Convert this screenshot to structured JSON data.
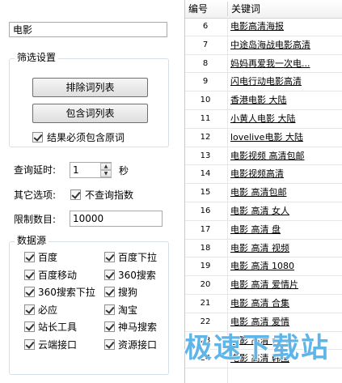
{
  "keyword_input": {
    "value": "电影"
  },
  "filter_group": {
    "title": "筛选设置",
    "exclude_button": "排除词列表",
    "include_button": "包含词列表",
    "must_contain_label": "结果必须包含原词",
    "must_contain_checked": true
  },
  "query_delay": {
    "label": "查询延时:",
    "value": "1",
    "unit": "秒"
  },
  "other_options": {
    "label": "其它选项:",
    "no_index_label": "不查询指数",
    "no_index_checked": true
  },
  "limit": {
    "label": "限制数目:",
    "value": "10000"
  },
  "sources_group": {
    "title": "数据源",
    "items": [
      {
        "label": "百度",
        "checked": true
      },
      {
        "label": "百度下拉",
        "checked": true
      },
      {
        "label": "百度移动",
        "checked": true
      },
      {
        "label": "360搜索",
        "checked": true
      },
      {
        "label": "360搜索下拉",
        "checked": true
      },
      {
        "label": "搜狗",
        "checked": true
      },
      {
        "label": "必应",
        "checked": true
      },
      {
        "label": "淘宝",
        "checked": true
      },
      {
        "label": "站长工具",
        "checked": true
      },
      {
        "label": "神马搜索",
        "checked": true
      },
      {
        "label": "云端接口",
        "checked": true
      },
      {
        "label": "资源接口",
        "checked": true
      }
    ]
  },
  "results": {
    "headers": {
      "num": "编号",
      "keyword": "关键词"
    },
    "rows": [
      {
        "num": "6",
        "keyword": "电影高清海报"
      },
      {
        "num": "7",
        "keyword": "中途岛海战电影高清"
      },
      {
        "num": "8",
        "keyword": "妈妈再爱我一次电..."
      },
      {
        "num": "9",
        "keyword": "闪电行动电影高清"
      },
      {
        "num": "10",
        "keyword": "香港电影 大陆"
      },
      {
        "num": "11",
        "keyword": "小黄人电影 大陆"
      },
      {
        "num": "12",
        "keyword": "lovelive电影 大陆"
      },
      {
        "num": "13",
        "keyword": "电影视频 高清包邮"
      },
      {
        "num": "14",
        "keyword": "电影视频高清"
      },
      {
        "num": "15",
        "keyword": "电影 高清包邮"
      },
      {
        "num": "16",
        "keyword": "电影 高清 女人"
      },
      {
        "num": "17",
        "keyword": "电影 高清 盘"
      },
      {
        "num": "18",
        "keyword": "电影 高清 视频"
      },
      {
        "num": "19",
        "keyword": "电影 高清 1080"
      },
      {
        "num": "20",
        "keyword": "电影 高清 爱情片"
      },
      {
        "num": "21",
        "keyword": "电影 高清 合集"
      },
      {
        "num": "22",
        "keyword": "电影 高清 爱情"
      },
      {
        "num": "23",
        "keyword": "电影 高清 大片"
      },
      {
        "num": "24",
        "keyword": "电影 高清 韩国"
      }
    ]
  },
  "watermark": "极速下载站"
}
